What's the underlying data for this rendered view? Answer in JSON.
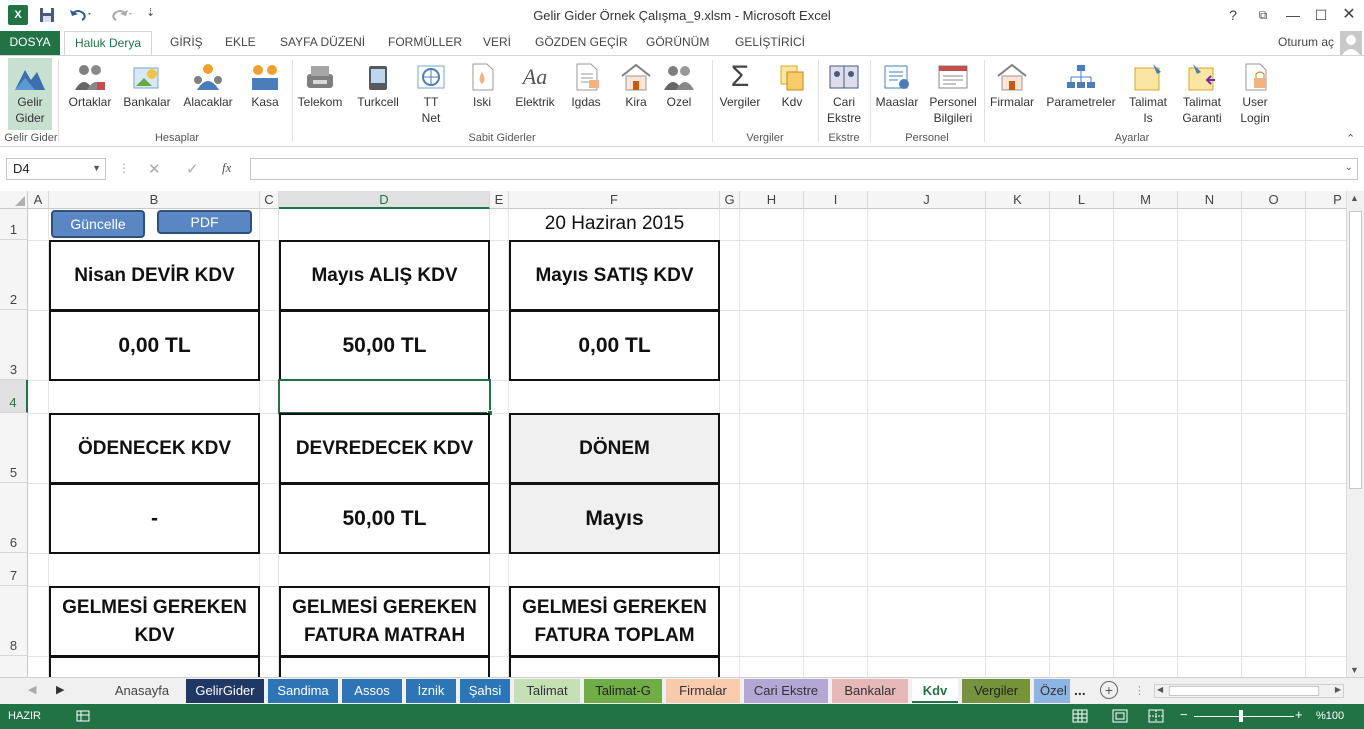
{
  "window": {
    "title": "Gelir Gider Örnek Çalışma_9.xlsm - Microsoft Excel",
    "help": "?",
    "signin": "Oturum aç"
  },
  "ribbon_tabs": [
    "DOSYA",
    "Haluk Derya",
    "GİRİŞ",
    "EKLE",
    "SAYFA DÜZENİ",
    "FORMÜLLER",
    "VERİ",
    "GÖZDEN GEÇİR",
    "GÖRÜNÜM",
    "GELİŞTİRİCİ"
  ],
  "ribbon": {
    "buttons": [
      {
        "label": "Gelir\nGider",
        "icon": "chart-mountain-icon"
      },
      {
        "label": "Ortaklar",
        "icon": "people-group-icon"
      },
      {
        "label": "Bankalar",
        "icon": "bank-icon"
      },
      {
        "label": "Alacaklar",
        "icon": "receivables-icon"
      },
      {
        "label": "Kasa",
        "icon": "cash-box-icon"
      },
      {
        "label": "Telekom",
        "icon": "telephone-icon"
      },
      {
        "label": "Turkcell",
        "icon": "mobile-phone-icon"
      },
      {
        "label": "TT\nNet",
        "icon": "internet-icon"
      },
      {
        "label": "Iski",
        "icon": "water-document-icon"
      },
      {
        "label": "Elektrik",
        "icon": "electricity-text-icon"
      },
      {
        "label": "Igdas",
        "icon": "gas-document-icon"
      },
      {
        "label": "Kira",
        "icon": "house-icon"
      },
      {
        "label": "Ozel",
        "icon": "people-icon"
      },
      {
        "label": "Vergiler",
        "icon": "sigma-icon"
      },
      {
        "label": "Kdv",
        "icon": "copy-pages-icon"
      },
      {
        "label": "Cari\nEkstre",
        "icon": "account-book-icon"
      },
      {
        "label": "Maaslar",
        "icon": "salary-icon"
      },
      {
        "label": "Personel\nBilgileri",
        "icon": "personnel-form-icon"
      },
      {
        "label": "Firmalar",
        "icon": "building-icon"
      },
      {
        "label": "Parametreler",
        "icon": "org-chart-icon"
      },
      {
        "label": "Talimat\nIs",
        "icon": "sticky-note-icon"
      },
      {
        "label": "Talimat\nGaranti",
        "icon": "instruction-note-icon"
      },
      {
        "label": "User\nLogin",
        "icon": "user-lock-icon"
      }
    ],
    "groups": [
      "Gelir Gider",
      "Hesaplar",
      "Sabit Giderler",
      "Vergiler",
      "Ekstre",
      "Personel",
      "Ayarlar"
    ]
  },
  "formula_bar": {
    "name_box": "D4",
    "fx": "fx",
    "formula": ""
  },
  "columns": [
    "A",
    "B",
    "C",
    "D",
    "E",
    "F",
    "G",
    "H",
    "I",
    "J",
    "K",
    "L",
    "M",
    "N",
    "O",
    "P"
  ],
  "rows": [
    "1",
    "2",
    "3",
    "4",
    "5",
    "6",
    "7",
    "8"
  ],
  "sheet": {
    "buttons": {
      "update": "Güncelle",
      "pdf": "PDF"
    },
    "date": "20 Haziran 2015",
    "cells": {
      "b2": "Nisan DEVİR KDV",
      "b3": "0,00 TL",
      "d2": "Mayıs ALIŞ KDV",
      "d3": "50,00 TL",
      "f2": "Mayıs SATIŞ KDV",
      "f3": "0,00 TL",
      "b5": "ÖDENECEK KDV",
      "b6": "-",
      "d5": "DEVREDECEK KDV",
      "d6": "50,00 TL",
      "f5": "DÖNEM",
      "f6": "Mayıs",
      "b8": "GELMESİ GEREKEN KDV",
      "d8_1": "GELMESİ GEREKEN",
      "d8_2": "FATURA MATRAH",
      "f8_1": "GELMESİ GEREKEN",
      "f8_2": "FATURA TOPLAM"
    }
  },
  "sheet_tabs": [
    {
      "label": "Anasayfa",
      "color": "#f0f0f0",
      "text": "#444"
    },
    {
      "label": "GelirGider",
      "color": "#1f3864",
      "text": "#ffffff"
    },
    {
      "label": "Sandima",
      "color": "#2e75b6",
      "text": "#ffffff"
    },
    {
      "label": "Assos",
      "color": "#2e75b6",
      "text": "#ffffff"
    },
    {
      "label": "İznik",
      "color": "#2e75b6",
      "text": "#ffffff"
    },
    {
      "label": "Şahsi",
      "color": "#2e75b6",
      "text": "#ffffff"
    },
    {
      "label": "Talimat",
      "color": "#c5e0b4",
      "text": "#333333"
    },
    {
      "label": "Talimat-G",
      "color": "#70ad47",
      "text": "#222222"
    },
    {
      "label": "Firmalar",
      "color": "#f8cbad",
      "text": "#333333"
    },
    {
      "label": "Cari Ekstre",
      "color": "#b4a7d6",
      "text": "#333333"
    },
    {
      "label": "Bankalar",
      "color": "#e6b8b7",
      "text": "#333333"
    },
    {
      "label": "Kdv",
      "color": "#ffffff",
      "text": "#217346"
    },
    {
      "label": "Vergiler",
      "color": "#76933c",
      "text": "#222222"
    },
    {
      "label": "Özel",
      "color": "#8eb4e3",
      "text": "#333333"
    }
  ],
  "sheet_more": "...",
  "status": {
    "ready": "HAZIR",
    "zoom": "%100"
  },
  "colors": {
    "accent": "#217346",
    "button": "#5b86c4"
  }
}
